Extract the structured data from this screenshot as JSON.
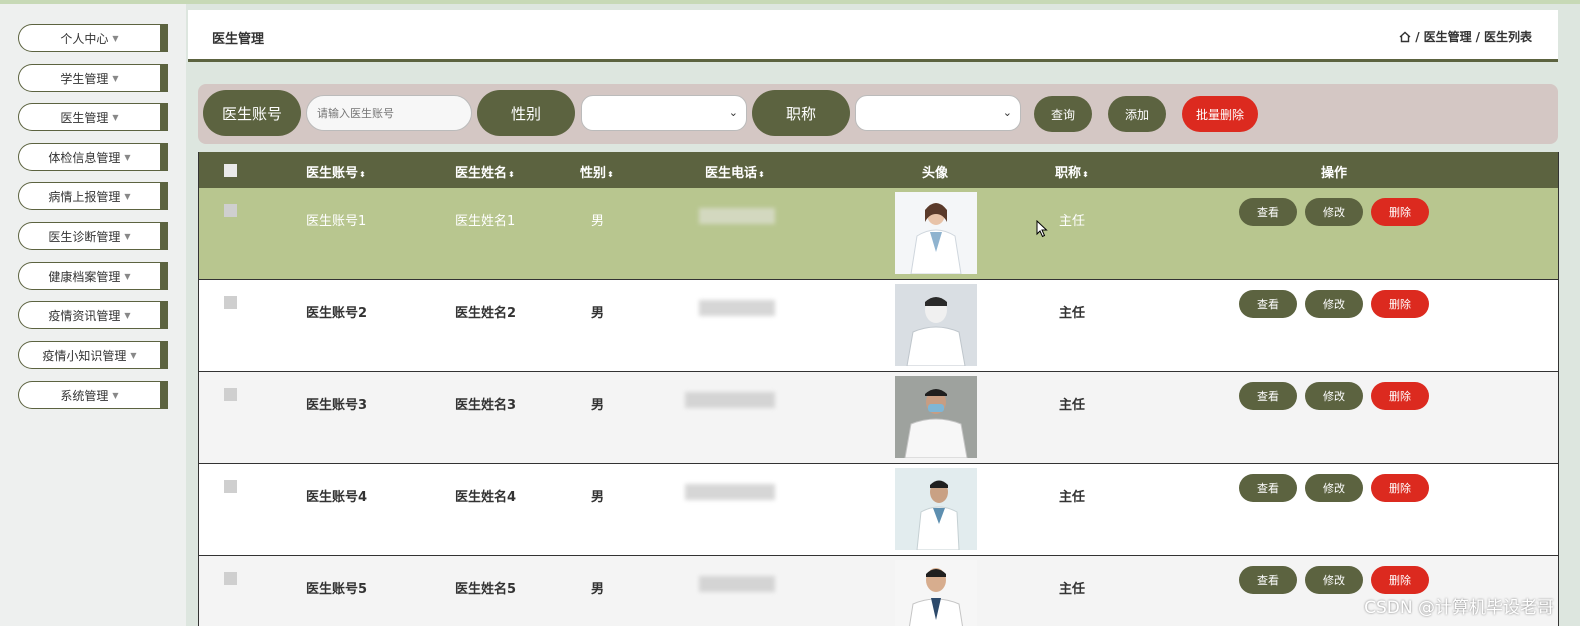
{
  "sidebar": {
    "items": [
      {
        "label": "个人中心"
      },
      {
        "label": "学生管理"
      },
      {
        "label": "医生管理"
      },
      {
        "label": "体检信息管理"
      },
      {
        "label": "病情上报管理"
      },
      {
        "label": "医生诊断管理"
      },
      {
        "label": "健康档案管理"
      },
      {
        "label": "疫情资讯管理"
      },
      {
        "label": "疫情小知识管理"
      },
      {
        "label": "系统管理"
      }
    ]
  },
  "header": {
    "title": "医生管理",
    "breadcrumb": [
      "医生管理",
      "医生列表"
    ],
    "separator": "/"
  },
  "search": {
    "account_label": "医生账号",
    "account_placeholder": "请输入医生账号",
    "gender_label": "性别",
    "gender_value": "",
    "title_label": "职称",
    "title_value": "",
    "query_button": "查询",
    "add_button": "添加",
    "batch_delete_button": "批量删除"
  },
  "table": {
    "headers": {
      "account": "医生账号",
      "name": "医生姓名",
      "gender": "性别",
      "phone": "医生电话",
      "avatar": "头像",
      "title": "职称",
      "actions": "操作"
    },
    "sort_icon": "⬍",
    "rows": [
      {
        "account": "医生账号1",
        "name": "医生姓名1",
        "gender": "男",
        "title": "主任"
      },
      {
        "account": "医生账号2",
        "name": "医生姓名2",
        "gender": "男",
        "title": "主任"
      },
      {
        "account": "医生账号3",
        "name": "医生姓名3",
        "gender": "男",
        "title": "主任"
      },
      {
        "account": "医生账号4",
        "name": "医生姓名4",
        "gender": "男",
        "title": "主任"
      },
      {
        "account": "医生账号5",
        "name": "医生姓名5",
        "gender": "男",
        "title": "主任"
      }
    ],
    "action_labels": {
      "view": "查看",
      "edit": "修改",
      "delete": "删除"
    }
  },
  "watermark": "CSDN @计算机毕设老哥",
  "colors": {
    "accent": "#5c6340",
    "danger": "#dc2a1f",
    "row_highlight": "#b8c68f",
    "search_bg": "#d4c7c4"
  }
}
